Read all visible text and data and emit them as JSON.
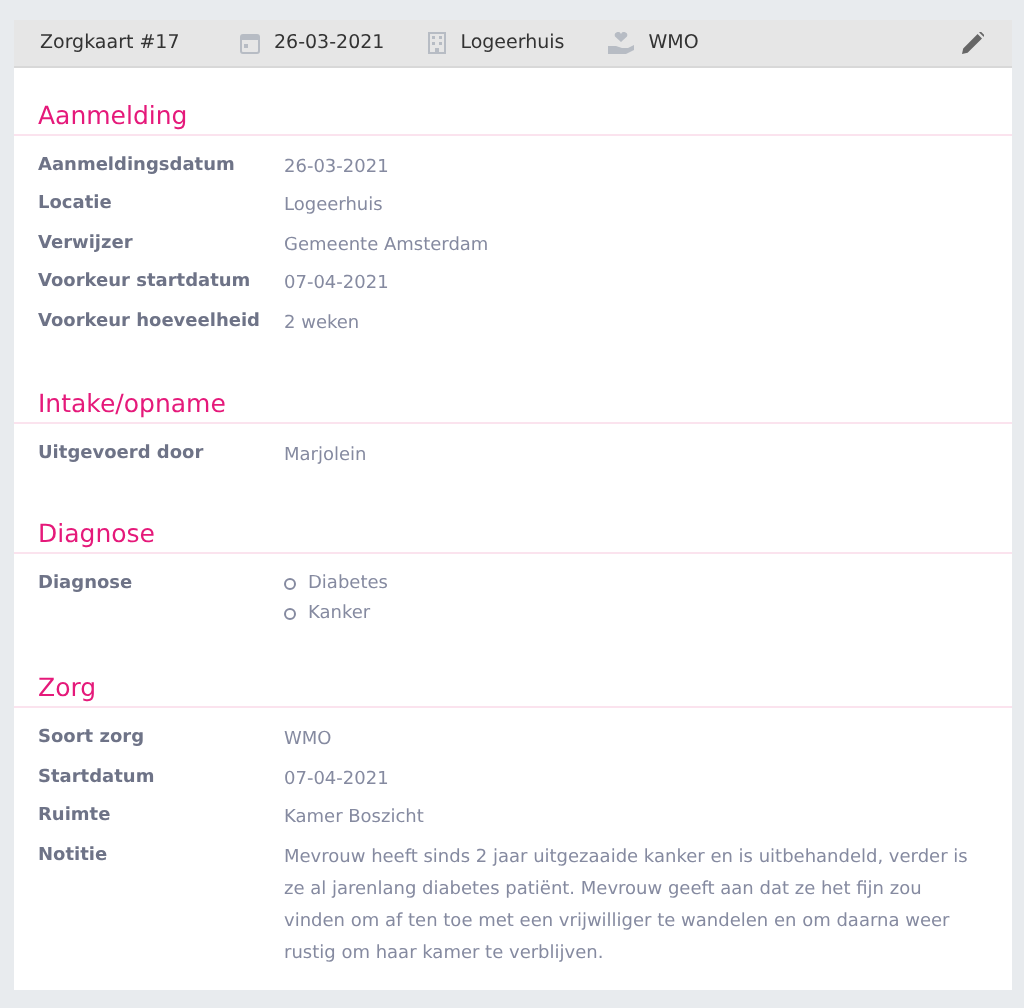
{
  "header": {
    "title": "Zorgkaart #17",
    "meta": [
      {
        "kind": "date",
        "text": "26-03-2021"
      },
      {
        "kind": "building",
        "text": "Logeerhuis"
      },
      {
        "kind": "care",
        "text": "WMO"
      }
    ]
  },
  "sections": [
    {
      "title": "Aanmelding",
      "fields": [
        {
          "label": "Aanmeldingsdatum",
          "kind": "text",
          "value": "26-03-2021"
        },
        {
          "label": "Locatie",
          "kind": "text",
          "value": "Logeerhuis"
        },
        {
          "label": "Verwijzer",
          "kind": "text",
          "value": "Gemeente Amsterdam"
        },
        {
          "label": "Voorkeur startdatum",
          "kind": "text",
          "value": "07-04-2021"
        },
        {
          "label": "Voorkeur hoeveelheid",
          "kind": "text",
          "value": "2 weken"
        }
      ]
    },
    {
      "title": "Intake/opname",
      "fields": [
        {
          "label": "Uitgevoerd door",
          "kind": "text",
          "value": "Marjolein"
        }
      ]
    },
    {
      "title": "Diagnose",
      "fields": [
        {
          "label": "Diagnose",
          "kind": "list",
          "items": [
            "Diabetes",
            "Kanker"
          ]
        }
      ]
    },
    {
      "title": "Zorg",
      "fields": [
        {
          "label": "Soort zorg",
          "kind": "text",
          "value": "WMO"
        },
        {
          "label": "Startdatum",
          "kind": "text",
          "value": "07-04-2021"
        },
        {
          "label": "Ruimte",
          "kind": "text",
          "value": "Kamer Boszicht"
        },
        {
          "label": "Notitie",
          "kind": "text",
          "value": "Mevrouw heeft sinds 2 jaar uitgezaaide kanker en is uitbehandeld, verder is ze al jarenlang diabetes patiënt. Mevrouw geeft aan dat ze het fijn zou vinden om af ten toe met een vrijwilliger te wandelen en om daarna weer rustig om haar kamer te verblijven."
        }
      ]
    }
  ]
}
